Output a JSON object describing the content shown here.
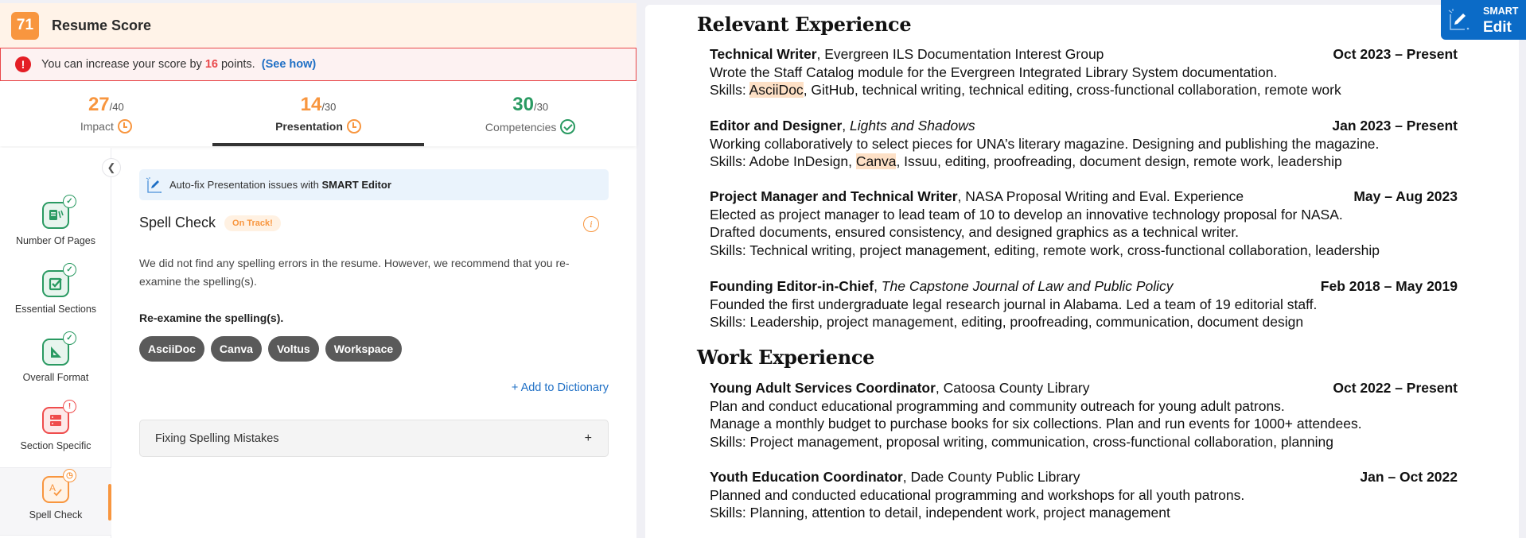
{
  "header": {
    "score": "71",
    "title": "Resume Score"
  },
  "alert": {
    "icon": "exclamation-icon",
    "text_before": "You can increase your score by",
    "points": "16",
    "text_after": "points.",
    "link": "(See how)"
  },
  "score_tabs": [
    {
      "score": "27",
      "max": "/40",
      "label": "Impact",
      "status": "clock-icon",
      "color": "#f8963f",
      "active": false
    },
    {
      "score": "14",
      "max": "/30",
      "label": "Presentation",
      "status": "clock-icon",
      "color": "#f8963f",
      "active": true
    },
    {
      "score": "30",
      "max": "/30",
      "label": "Competencies",
      "status": "check-circle-icon",
      "color": "#2a9a62",
      "active": false
    }
  ],
  "sidebar": {
    "collapse_icon": "chevron-left-icon",
    "items": [
      {
        "label": "Number Of Pages",
        "icon": "pages-icon",
        "status": "check",
        "color": "green"
      },
      {
        "label": "Essential Sections",
        "icon": "checkbox-icon",
        "status": "check",
        "color": "green"
      },
      {
        "label": "Overall Format",
        "icon": "set-square-icon",
        "status": "check",
        "color": "green"
      },
      {
        "label": "Section Specific",
        "icon": "server-icon",
        "status": "alert",
        "color": "red"
      },
      {
        "label": "Spell Check",
        "icon": "spell-check-icon",
        "status": "pending",
        "color": "orange",
        "active": true
      }
    ]
  },
  "content": {
    "banner_text": "Auto-fix Presentation issues with",
    "banner_bold": "SMART Editor",
    "section_title": "Spell Check",
    "status_badge": "On Track!",
    "info_icon": "i",
    "description": "We did not find any spelling errors in the resume. However, we recommend that you re-examine the spelling(s).",
    "reexamine_label": "Re-examine the spelling(s).",
    "words": [
      "AsciiDoc",
      "Canva",
      "Voltus",
      "Workspace"
    ],
    "add_dictionary": "+ Add to Dictionary",
    "accordion_label": "Fixing Spelling Mistakes",
    "accordion_icon": "+"
  },
  "smart_edit": {
    "top": "SMART",
    "bottom": "Edit"
  },
  "resume": {
    "headings": {
      "relevant": "Relevant Experience",
      "work": "Work Experience"
    },
    "colors": {
      "highlight": "#fde0c6"
    },
    "entries": [
      {
        "role": "Technical Writer",
        "org": ", Evergreen ILS Documentation Interest Group",
        "org_italic": "",
        "date": "Oct 2023 – Present",
        "lines": [
          "Wrote the Staff Catalog module for the Evergreen Integrated Library System documentation."
        ],
        "skills_prefix": "Skills: ",
        "skills_highlight": "AsciiDoc",
        "skills_rest": ", GitHub, technical writing, technical editing, cross-functional collaboration, remote work"
      },
      {
        "role": "Editor and Designer",
        "org": ", ",
        "org_italic": "Lights and Shadows",
        "date": "Jan 2023 – Present",
        "lines": [
          "Working collaboratively to select pieces for UNA’s literary magazine. Designing and publishing the magazine."
        ],
        "skills_prefix": "Skills: Adobe InDesign, ",
        "skills_highlight": "Canva",
        "skills_rest": ", Issuu, editing, proofreading, document design, remote work, leadership"
      },
      {
        "role": "Project Manager and Technical Writer",
        "org": ", NASA Proposal Writing and Eval. Experience",
        "org_italic": "",
        "date": "May – Aug 2023",
        "lines": [
          "Elected as project manager to lead team of 10 to develop an innovative technology proposal for NASA.",
          "Drafted documents, ensured consistency, and designed graphics as a technical writer."
        ],
        "skills_prefix": "Skills: Technical writing, project management, editing, remote work, cross-functional collaboration, leadership",
        "skills_highlight": "",
        "skills_rest": ""
      },
      {
        "role": "Founding Editor-in-Chief",
        "org": ", ",
        "org_italic": "The Capstone Journal of Law and Public Policy",
        "date": "Feb 2018 – May 2019",
        "lines": [
          "Founded the first undergraduate legal research journal in Alabama. Led a team of 19 editorial staff."
        ],
        "skills_prefix": "Skills: Leadership, project management, editing, proofreading, communication, document design",
        "skills_highlight": "",
        "skills_rest": ""
      },
      {
        "role": "Young Adult Services Coordinator",
        "org": ", Catoosa County Library",
        "org_italic": "",
        "date": "Oct 2022 – Present",
        "lines": [
          "Plan and conduct educational programming and community outreach for young adult patrons.",
          "Manage a monthly budget to purchase books for six collections. Plan and run events for 1000+ attendees."
        ],
        "skills_prefix": "Skills: Project management, proposal writing, communication, cross-functional collaboration, planning",
        "skills_highlight": "",
        "skills_rest": ""
      },
      {
        "role": "Youth Education Coordinator",
        "org": ", Dade County Public Library",
        "org_italic": "",
        "date": "Jan – Oct 2022",
        "lines": [
          "Planned and conducted educational programming and workshops for all youth patrons."
        ],
        "skills_prefix": "Skills: Planning, attention to detail, independent work, project management",
        "skills_highlight": "",
        "skills_rest": ""
      }
    ]
  }
}
